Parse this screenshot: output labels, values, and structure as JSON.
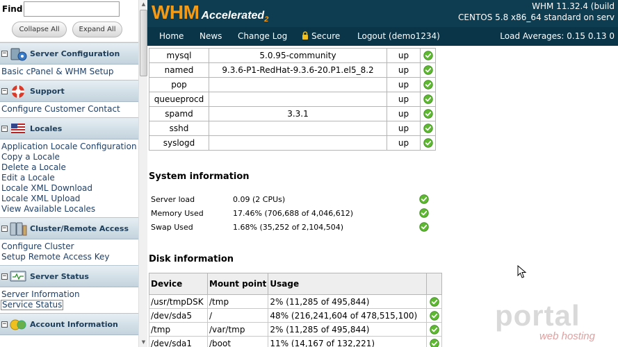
{
  "sidebar": {
    "find_label": "Find",
    "find_value": "",
    "collapse_label": "Collapse All",
    "expand_label": "Expand All",
    "sections": [
      {
        "title": "Server Configuration",
        "icon": "server-configuration-icon",
        "items": [
          "Basic cPanel & WHM Setup"
        ]
      },
      {
        "title": "Support",
        "icon": "lifebuoy-icon",
        "items": [
          "Configure Customer Contact"
        ]
      },
      {
        "title": "Locales",
        "icon": "flag-icon",
        "items": [
          "Application Locale Configuration",
          "Copy a Locale",
          "Delete a Locale",
          "Edit a Locale",
          "Locale XML Download",
          "Locale XML Upload",
          "View Available Locales"
        ]
      },
      {
        "title": "Cluster/Remote Access",
        "icon": "cluster-icon",
        "items": [
          "Configure Cluster",
          "Setup Remote Access Key"
        ]
      },
      {
        "title": "Server Status",
        "icon": "server-status-icon",
        "items": [
          "Server Information",
          "Service Status"
        ]
      },
      {
        "title": "Account Information",
        "icon": "account-icon",
        "items": []
      }
    ]
  },
  "header": {
    "logo_main": "WHM",
    "logo_sub": "Accelerated",
    "logo_num": "2",
    "version": "WHM 11.32.4 (build",
    "os": "CENTOS 5.8 x86_64 standard on serv",
    "nav": {
      "home": "Home",
      "news": "News",
      "changelog": "Change Log",
      "secure": "Secure",
      "logout": "Logout (demo1234)"
    },
    "load_averages": "Load Averages: 0.15 0.13 0"
  },
  "services": [
    {
      "name": "mysql",
      "version": "5.0.95-community",
      "status": "up"
    },
    {
      "name": "named",
      "version": "9.3.6-P1-RedHat-9.3.6-20.P1.el5_8.2",
      "status": "up"
    },
    {
      "name": "pop",
      "version": "",
      "status": "up"
    },
    {
      "name": "queueprocd",
      "version": "",
      "status": "up"
    },
    {
      "name": "spamd",
      "version": "3.3.1",
      "status": "up"
    },
    {
      "name": "sshd",
      "version": "",
      "status": "up"
    },
    {
      "name": "syslogd",
      "version": "",
      "status": "up"
    }
  ],
  "system_info": {
    "heading": "System information",
    "rows": [
      {
        "label": "Server load",
        "value": "0.09 (2 CPUs)"
      },
      {
        "label": "Memory Used",
        "value": "17.46% (706,688 of 4,046,612)"
      },
      {
        "label": "Swap Used",
        "value": "1.68% (35,252 of 2,104,504)"
      }
    ]
  },
  "disk_info": {
    "heading": "Disk information",
    "columns": [
      "Device",
      "Mount point",
      "Usage"
    ],
    "rows": [
      {
        "device": "/usr/tmpDSK",
        "mount": "/tmp",
        "usage": "2% (11,285 of 495,844)"
      },
      {
        "device": "/dev/sda5",
        "mount": "/",
        "usage": "48% (216,241,604 of 478,515,100)"
      },
      {
        "device": "/tmp",
        "mount": "/var/tmp",
        "usage": "2% (11,285 of 495,844)"
      },
      {
        "device": "/dev/sda1",
        "mount": "/boot",
        "usage": "11% (14,167 of 132,221)"
      }
    ]
  },
  "watermark": {
    "word": "portal",
    "sub": "web hosting"
  },
  "colors": {
    "header_bg": "#0e3d52",
    "logo_orange": "#f39b16",
    "ok_green": "#5fb832",
    "nav_link": "#1f3f66"
  }
}
